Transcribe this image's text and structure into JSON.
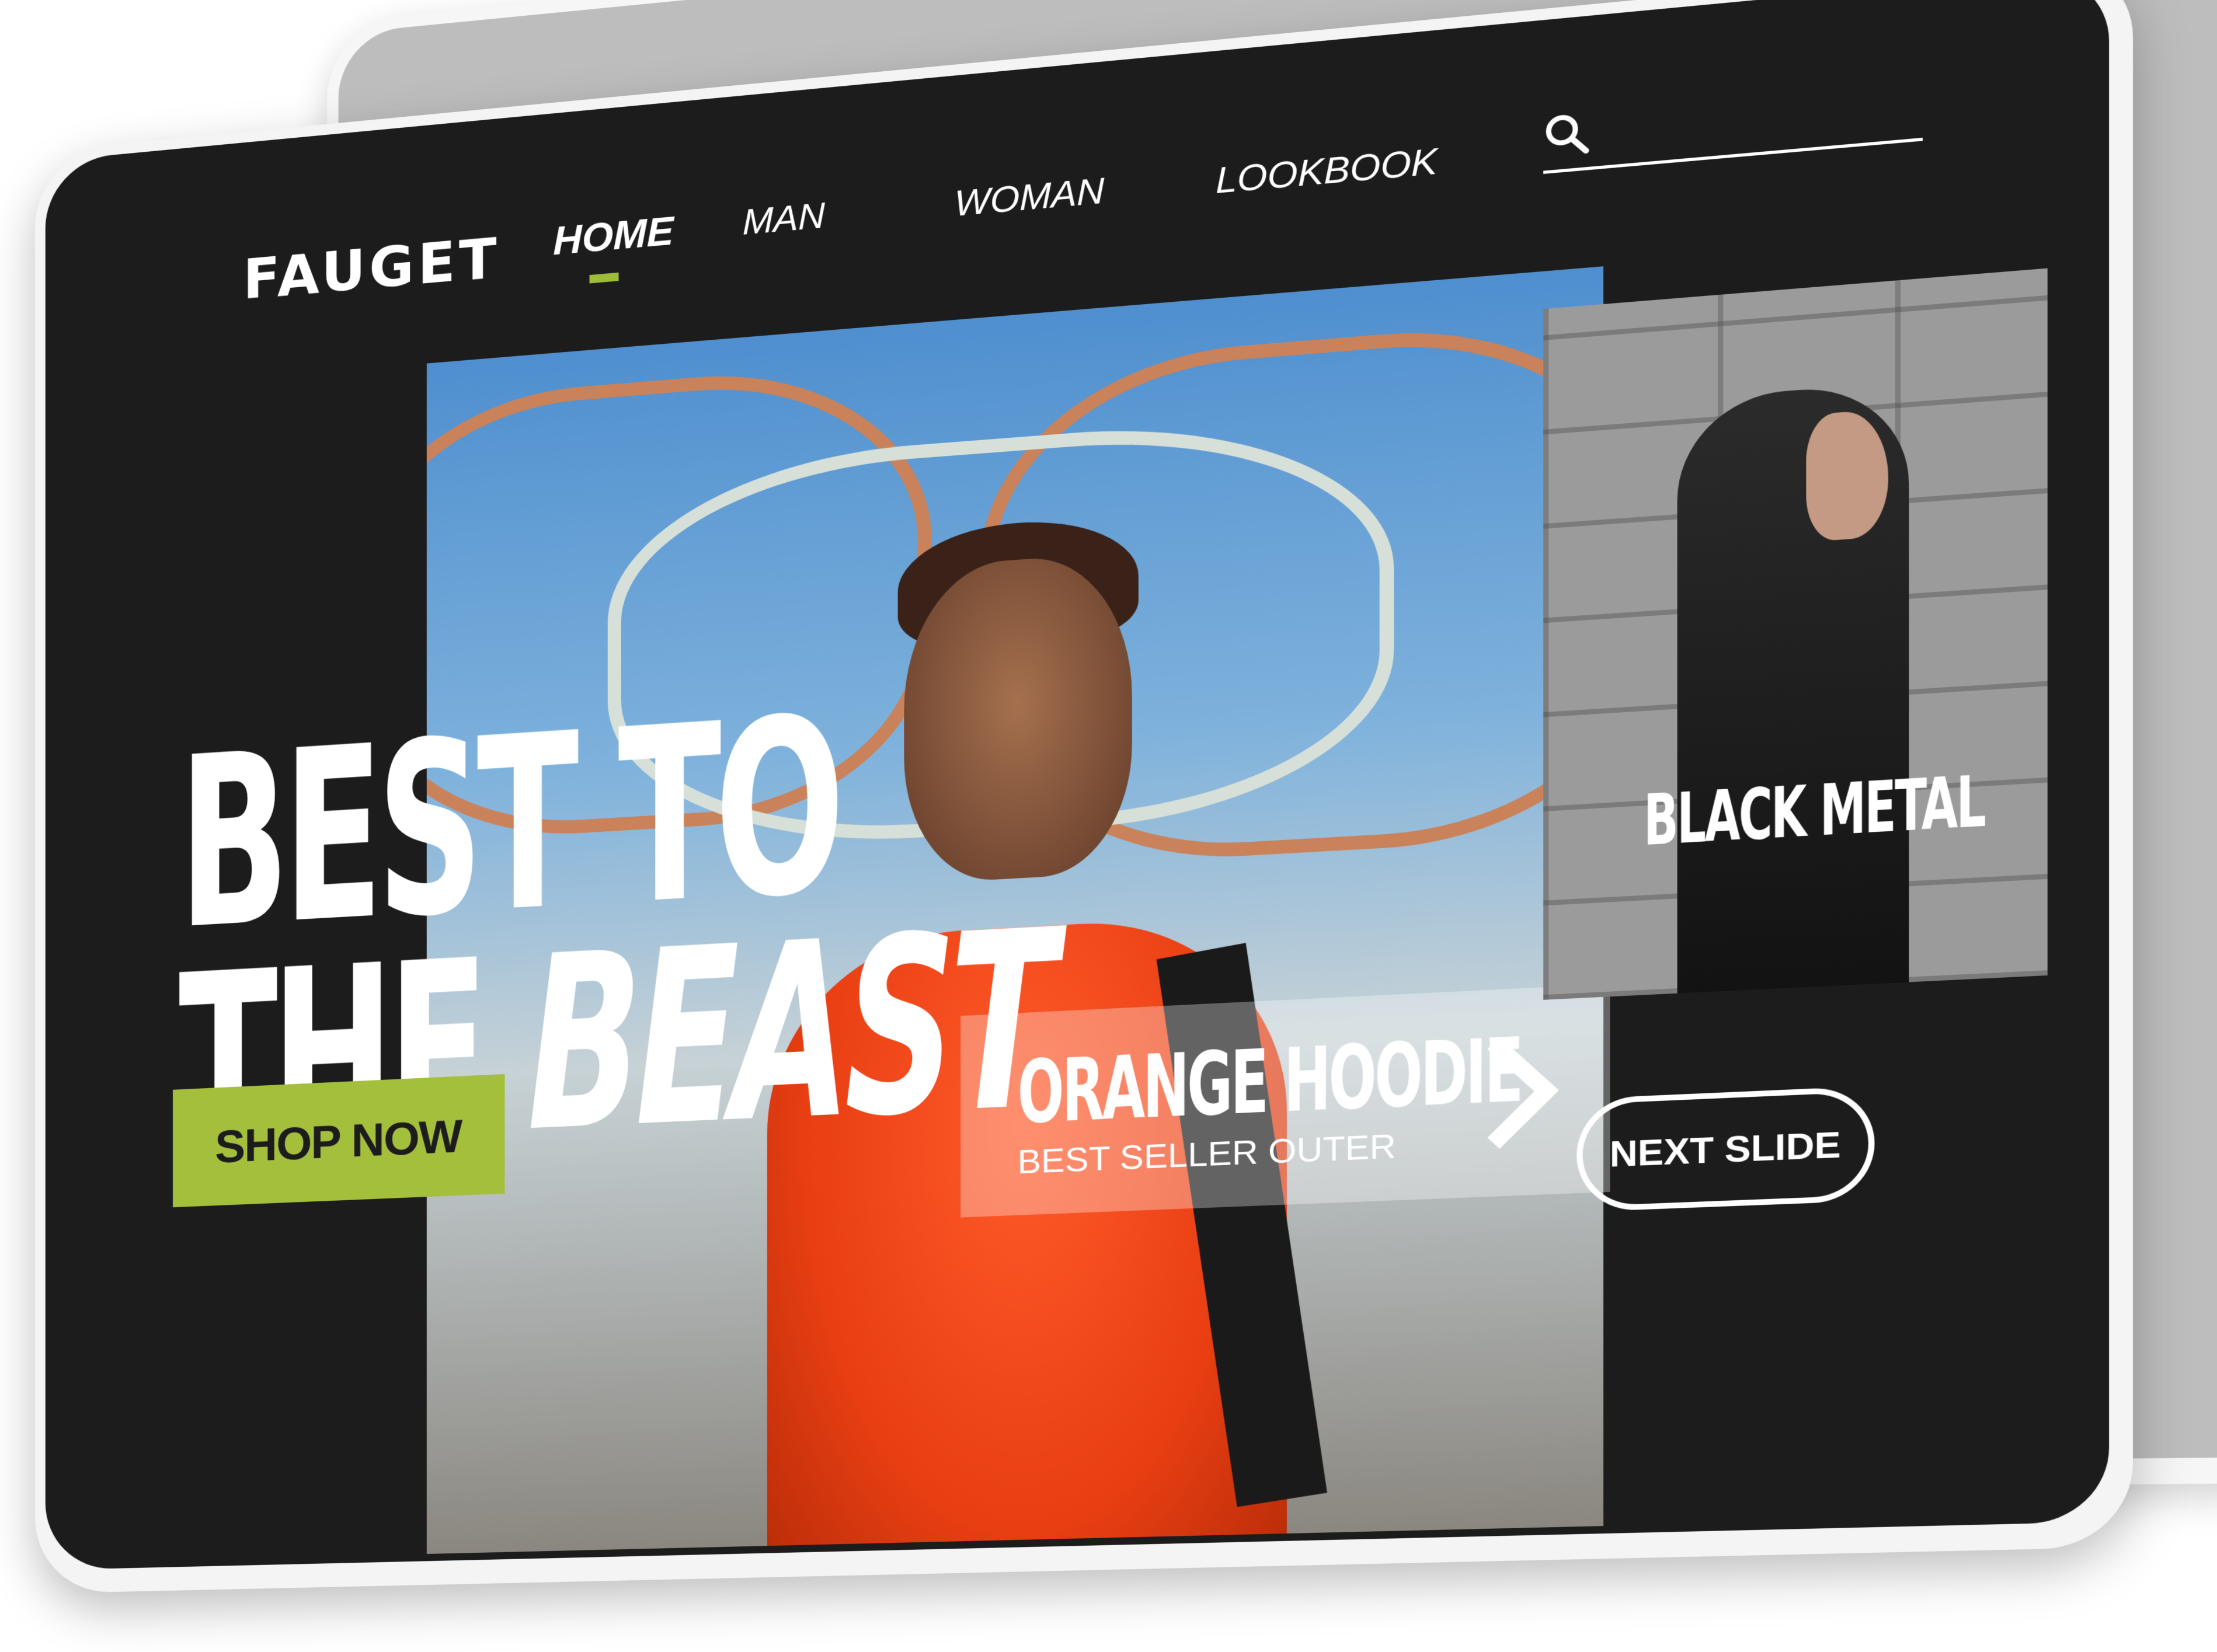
{
  "brand": {
    "logo": "FAUGET",
    "accent_color": "#a4bf3c"
  },
  "nav": {
    "items": [
      {
        "label": "HOME",
        "active": true
      },
      {
        "label": "MAN",
        "active": false
      },
      {
        "label": "WOMAN",
        "active": false
      },
      {
        "label": "LOOKBOOK",
        "active": false
      }
    ]
  },
  "search": {
    "placeholder": "",
    "icon": "search-icon"
  },
  "hero": {
    "headline_line1": "BEST TO",
    "headline_line2_a": "THE ",
    "headline_line2_b": "BEAST",
    "cta_label": "SHOP NOW"
  },
  "featured_product": {
    "title": "ORANGE HOODIE",
    "subtitle": "BEST SELLER OUTER",
    "next_icon": "chevron-right-icon"
  },
  "side_card": {
    "label": "BLACK METAL"
  },
  "carousel": {
    "next_label": "NEXT SLIDE"
  }
}
